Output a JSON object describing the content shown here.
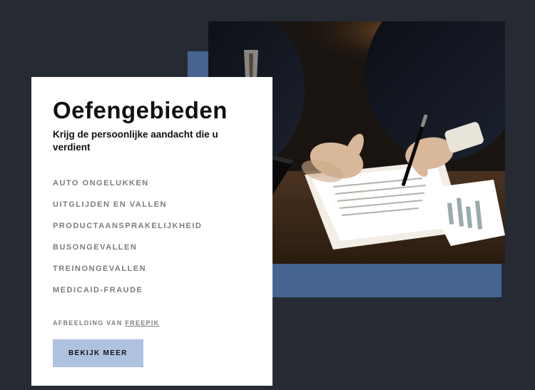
{
  "card": {
    "title": "Oefengebieden",
    "subtitle": "Krijg de persoonlijke aandacht die u verdient",
    "practice_areas": [
      "AUTO ONGELUKKEN",
      "UITGLIJDEN EN VALLEN",
      "PRODUCTAANSPRAKELIJKHEID",
      "BUSONGEVALLEN",
      "TREINONGEVALLEN",
      "MEDICAID-FRAUDE"
    ],
    "credit_prefix": "AFBEELDING VAN ",
    "credit_link": "FREEPIK",
    "cta_label": "BEKIJK MEER"
  },
  "colors": {
    "page_bg": "#252a33",
    "frame_bg": "#456490",
    "card_bg": "#ffffff",
    "cta_bg": "#aec1df",
    "muted_text": "#7a7d82"
  }
}
